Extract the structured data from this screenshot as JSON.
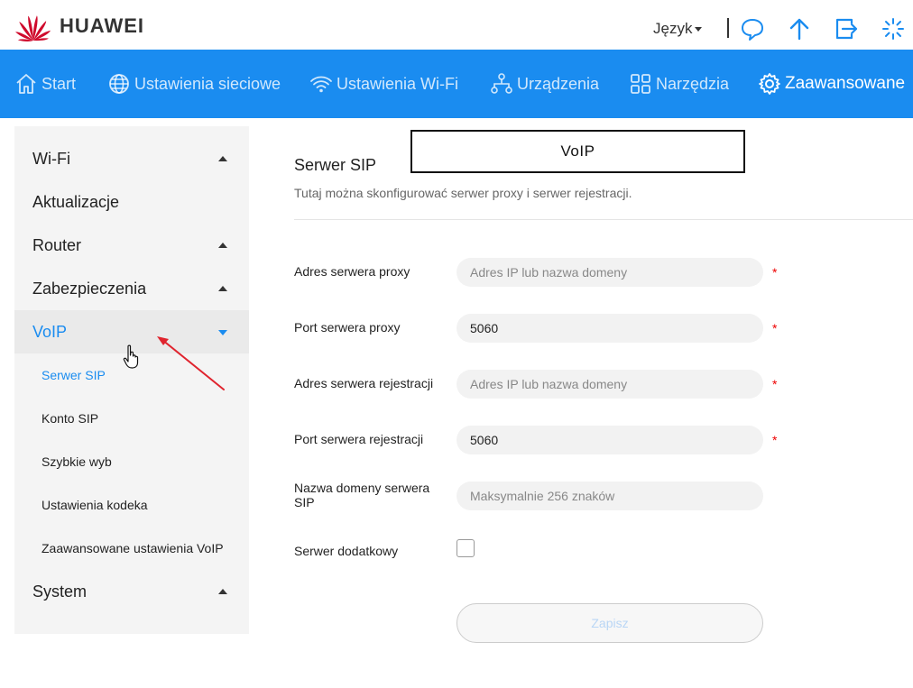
{
  "header": {
    "brand": "HUAWEI",
    "language_label": "Język"
  },
  "nav": {
    "items": [
      {
        "label": "Start",
        "icon": "home-icon"
      },
      {
        "label": "Ustawienia sieciowe",
        "icon": "globe-icon"
      },
      {
        "label": "Ustawienia Wi-Fi",
        "icon": "wifi-icon"
      },
      {
        "label": "Urządzenia",
        "icon": "devices-icon"
      },
      {
        "label": "Narzędzia",
        "icon": "tools-icon"
      },
      {
        "label": "Zaawansowane",
        "icon": "gear-icon",
        "active": true
      }
    ]
  },
  "sidebar": {
    "items": [
      {
        "label": "Wi-Fi"
      },
      {
        "label": "Aktualizacje"
      },
      {
        "label": "Router"
      },
      {
        "label": "Zabezpieczenia"
      },
      {
        "label": "VoIP",
        "active": true
      },
      {
        "label": "System"
      }
    ],
    "voip_sub": [
      {
        "label": "Serwer SIP",
        "active": true
      },
      {
        "label": "Konto SIP"
      },
      {
        "label": "Szybkie wyb"
      },
      {
        "label": "Ustawienia kodeka"
      },
      {
        "label": "Zaawansowane ustawienia VoIP"
      }
    ]
  },
  "main": {
    "title": "Serwer SIP",
    "annotation_box": "VoIP",
    "description": "Tutaj można skonfigurować serwer proxy i serwer rejestracji.",
    "fields": {
      "proxy_address": {
        "label": "Adres serwera proxy",
        "value": "",
        "placeholder": "Adres IP lub nazwa domeny",
        "required": "*"
      },
      "proxy_port": {
        "label": "Port serwera proxy",
        "value": "5060",
        "placeholder": "",
        "required": "*"
      },
      "registrar_address": {
        "label": "Adres serwera rejestracji",
        "value": "",
        "placeholder": "Adres IP lub nazwa domeny",
        "required": "*"
      },
      "registrar_port": {
        "label": "Port serwera rejestracji",
        "value": "5060",
        "placeholder": "",
        "required": "*"
      },
      "sip_domain": {
        "label": "Nazwa domeny serwera SIP",
        "value": "",
        "placeholder": "Maksymalnie 256 znaków"
      },
      "backup_server": {
        "label": "Serwer dodatkowy"
      }
    },
    "save_label": "Zapisz"
  },
  "colors": {
    "accent": "#1a8cf0",
    "required": "#e00000",
    "brand_red": "#cf0a2c"
  }
}
